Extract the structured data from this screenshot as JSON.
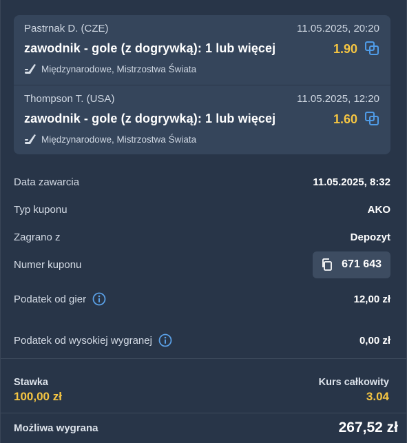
{
  "colors": {
    "background": "#283548",
    "card": "#35455b",
    "accent_odds": "#f5c542",
    "info_icon": "#5aa0e6"
  },
  "events": [
    {
      "player": "Pastrnak D. (CZE)",
      "datetime": "11.05.2025, 20:20",
      "market": "zawodnik - gole (z dogrywką): 1 lub więcej",
      "odds": "1.90",
      "sport_icon": "hockey-stick-icon",
      "league": "Międzynarodowe, Mistrzostwa Świata"
    },
    {
      "player": "Thompson T. (USA)",
      "datetime": "11.05.2025, 12:20",
      "market": "zawodnik - gole (z dogrywką): 1 lub więcej",
      "odds": "1.60",
      "sport_icon": "hockey-stick-icon",
      "league": "Międzynarodowe, Mistrzostwa Świata"
    }
  ],
  "details": {
    "date_label": "Data zawarcia",
    "date_value": "11.05.2025, 8:32",
    "type_label": "Typ kuponu",
    "type_value": "AKO",
    "source_label": "Zagrano z",
    "source_value": "Depozyt",
    "coupon_label": "Numer kuponu",
    "coupon_value": "671 643",
    "tax_label": "Podatek od gier",
    "tax_value": "12,00 zł",
    "high_tax_label": "Podatek od wysokiej wygranej",
    "high_tax_value": "0,00 zł"
  },
  "summary": {
    "stake_label": "Stawka",
    "stake_value": "100,00 zł",
    "total_odds_label": "Kurs całkowity",
    "total_odds_value": "3.04",
    "possible_win_label": "Możliwa wygrana",
    "possible_win_value": "267,52 zł"
  }
}
